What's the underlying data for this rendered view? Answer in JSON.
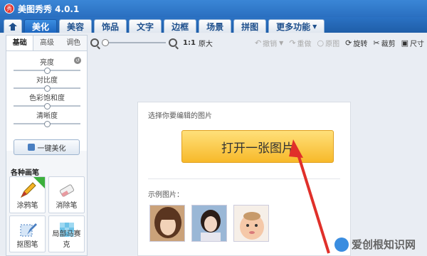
{
  "window": {
    "title": "美图秀秀 4.0.1",
    "logo_text": "秀"
  },
  "tabs": [
    {
      "label": "美化"
    },
    {
      "label": "美容"
    },
    {
      "label": "饰品"
    },
    {
      "label": "文字"
    },
    {
      "label": "边框"
    },
    {
      "label": "场景"
    },
    {
      "label": "拼图"
    },
    {
      "label": "更多功能"
    }
  ],
  "active_tab": "美化",
  "left_panel": {
    "subtabs": [
      "基础",
      "高级",
      "调色"
    ],
    "active_subtab": "基础",
    "sliders": [
      {
        "label": "亮度",
        "value": 0.5
      },
      {
        "label": "对比度",
        "value": 0.5
      },
      {
        "label": "色彩饱和度",
        "value": 0.5
      },
      {
        "label": "清晰度",
        "value": 0.5
      }
    ],
    "onekey_label": "一键美化",
    "brushes_title": "各种画笔",
    "tools": [
      {
        "label": "涂鸦笔"
      },
      {
        "label": "消除笔"
      },
      {
        "label": "抠图笔"
      },
      {
        "label": "局部马赛克"
      }
    ]
  },
  "toolbar": {
    "zoom_ratio": "1:1",
    "original_size": "原大",
    "undo": "撤销",
    "redo": "重做",
    "original_image": "原图",
    "rotate": "旋转",
    "crop": "裁剪",
    "resize": "尺寸"
  },
  "open_panel": {
    "prompt": "选择你要编辑的图片",
    "open_button": "打开一张图片",
    "samples_label": "示例图片："
  },
  "watermark": {
    "text": "爱创根知识网"
  },
  "colors": {
    "accent": "#2b72c4",
    "open_button": "#f7b92a",
    "arrow": "#e0302a"
  }
}
